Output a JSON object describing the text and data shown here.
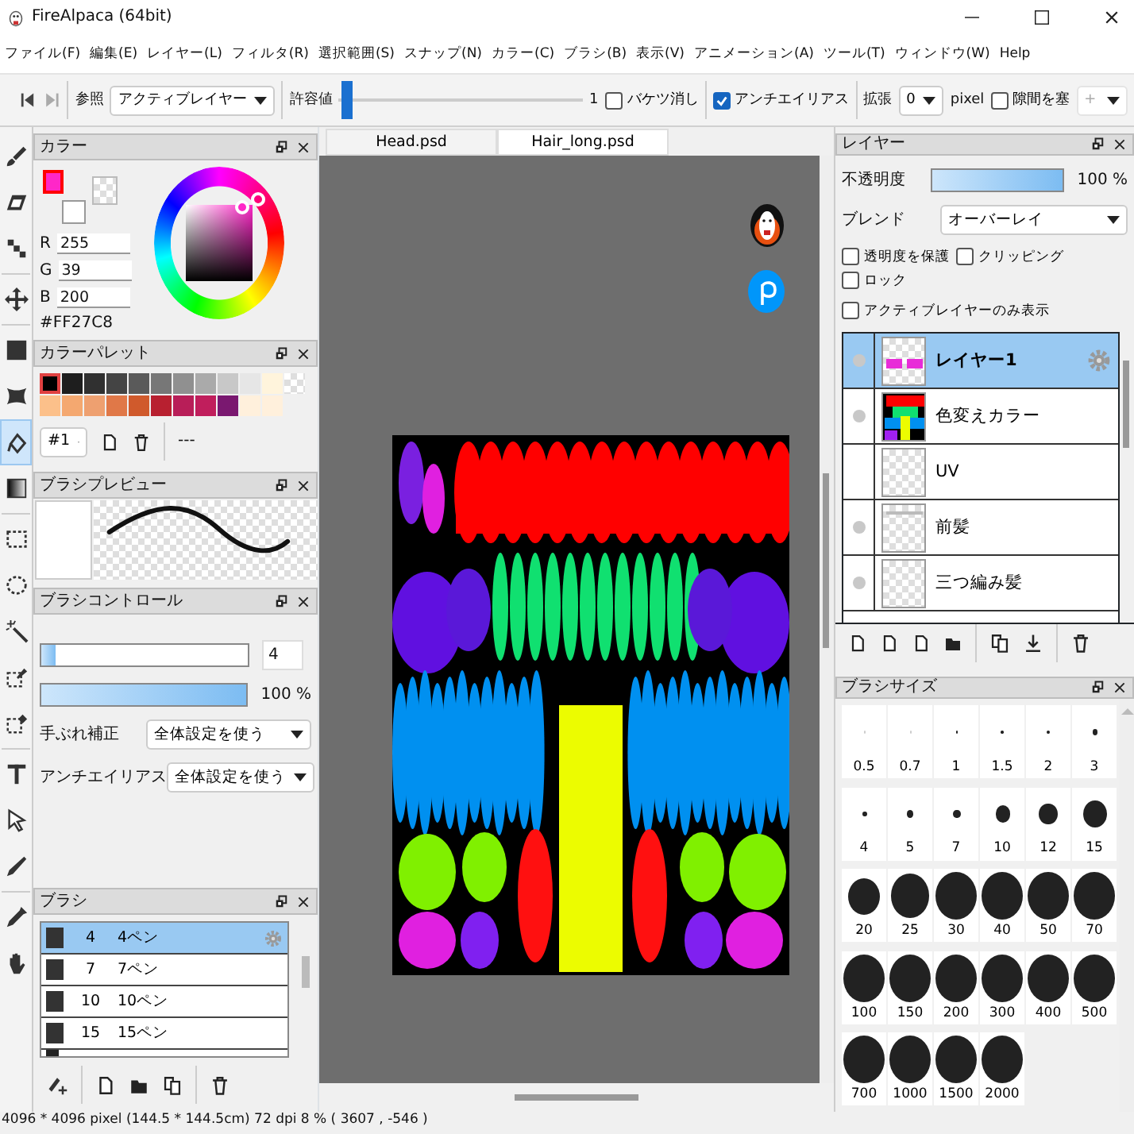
{
  "window": {
    "title": "FireAlpaca (64bit)"
  },
  "menu": [
    "ファイル(F)",
    "編集(E)",
    "レイヤー(L)",
    "フィルタ(R)",
    "選択範囲(S)",
    "スナップ(N)",
    "カラー(C)",
    "ブラシ(B)",
    "表示(V)",
    "アニメーション(A)",
    "ツール(T)",
    "ウィンドウ(W)",
    "Help"
  ],
  "toolbar": {
    "reference_label": "参照",
    "reference_value": "アクティブレイヤー",
    "tolerance_label": "許容値",
    "tolerance": {
      "level": 0.01,
      "reading": "1"
    },
    "bucket_erase": {
      "label": "バケツ消し",
      "checked": false
    },
    "antialias": {
      "label": "アンチエイリアス",
      "checked": true
    },
    "expand_label": "拡張",
    "expand_value": "0",
    "expand_unit": "pixel",
    "close_gap": {
      "label": "隙間を塞",
      "checked": false
    },
    "gap_value": "+"
  },
  "tools": [
    {
      "kind": "brush",
      "selected": false
    },
    {
      "kind": "eraser",
      "selected": false
    },
    {
      "kind": "dot",
      "selected": false
    },
    {
      "kind": "move",
      "selected": false
    },
    {
      "kind": "fill",
      "selected": false
    },
    {
      "kind": "shape",
      "selected": false
    },
    {
      "kind": "bucket",
      "selected": true
    },
    {
      "kind": "gradient",
      "selected": false
    },
    {
      "kind": "select",
      "selected": false
    },
    {
      "kind": "lasso",
      "selected": false
    },
    {
      "kind": "wand",
      "selected": false
    },
    {
      "kind": "selectpen",
      "selected": false
    },
    {
      "kind": "selecteraser",
      "selected": false
    },
    {
      "kind": "text",
      "selected": false
    },
    {
      "kind": "operation",
      "selected": false
    },
    {
      "kind": "edit",
      "selected": false
    },
    {
      "kind": "dropper",
      "selected": false
    },
    {
      "kind": "hand",
      "selected": false
    }
  ],
  "color": {
    "title": "カラー",
    "primary": {
      "color": "#ff27c8"
    },
    "channels": [
      {
        "label": "R",
        "value": "255"
      },
      {
        "label": "G",
        "value": "39"
      },
      {
        "label": "B",
        "value": "200"
      }
    ],
    "hex": "#FF27C8"
  },
  "palette": {
    "title": "カラーパレット",
    "swatches": [
      {
        "kind": "color",
        "color": "#000000",
        "selected": true
      },
      {
        "kind": "color",
        "color": "#1e1e1e",
        "selected": false
      },
      {
        "kind": "color",
        "color": "#303030",
        "selected": false
      },
      {
        "kind": "color",
        "color": "#444444",
        "selected": false
      },
      {
        "kind": "color",
        "color": "#5a5a5a",
        "selected": false
      },
      {
        "kind": "color",
        "color": "#777777",
        "selected": false
      },
      {
        "kind": "color",
        "color": "#909090",
        "selected": false
      },
      {
        "kind": "color",
        "color": "#aaaaaa",
        "selected": false
      },
      {
        "kind": "color",
        "color": "#c8c8c8",
        "selected": false
      },
      {
        "kind": "color",
        "color": "#e6e6e6",
        "selected": false
      },
      {
        "kind": "color",
        "color": "#fff4dc",
        "selected": false
      },
      {
        "kind": "transparent",
        "selected": false
      },
      {
        "kind": "color",
        "color": "#fcc08a",
        "selected": false
      },
      {
        "kind": "color",
        "color": "#f4a870",
        "selected": false
      },
      {
        "kind": "color",
        "color": "#eea070",
        "selected": false
      },
      {
        "kind": "color",
        "color": "#e07848",
        "selected": false
      },
      {
        "kind": "color",
        "color": "#d05a2c",
        "selected": false
      },
      {
        "kind": "color",
        "color": "#b82030",
        "selected": false
      },
      {
        "kind": "color",
        "color": "#b81e58",
        "selected": false
      },
      {
        "kind": "color",
        "color": "#c01e5c",
        "selected": false
      },
      {
        "kind": "color",
        "color": "#7a1870",
        "selected": false
      },
      {
        "kind": "color",
        "color": "#fff0dc",
        "selected": false
      },
      {
        "kind": "color",
        "color": "#fff0dc",
        "selected": false
      }
    ],
    "set": "#1",
    "note": "---"
  },
  "brush_preview": {
    "title": "ブラシプレビュー"
  },
  "brush_control": {
    "title": "ブラシコントロール",
    "size": {
      "level": 0.07,
      "reading": "4"
    },
    "opacity": {
      "level": 1,
      "reading": "100 %"
    },
    "stabilizer_label": "手ぶれ補正",
    "stabilizer_value": "全体設定を使う",
    "antialias_label": "アンチエイリアス",
    "antialias_value": "全体設定を使う"
  },
  "brushes": {
    "title": "ブラシ",
    "items": [
      {
        "size": "4",
        "name": "4ペン",
        "selected": true
      },
      {
        "size": "7",
        "name": "7ペン",
        "selected": false
      },
      {
        "size": "10",
        "name": "10ペン",
        "selected": false
      },
      {
        "size": "15",
        "name": "15ペン",
        "selected": false
      }
    ]
  },
  "tabs": [
    {
      "label": "Head.psd",
      "selected": false
    },
    {
      "label": "Hair_long.psd",
      "selected": true
    }
  ],
  "layers": {
    "title": "レイヤー",
    "opacity_label": "不透明度",
    "opacity": {
      "level": 1,
      "reading": "100 %"
    },
    "blend_label": "ブレンド",
    "blend_value": "オーバーレイ",
    "options": [
      {
        "label": "透明度を保護",
        "checked": false
      },
      {
        "label": "クリッピング",
        "checked": false
      },
      {
        "label": "ロック",
        "checked": false
      },
      {
        "label": "アクティブレイヤーのみ表示",
        "checked": false
      }
    ],
    "items": [
      {
        "name": "レイヤー1",
        "kind": "marks",
        "visible": true,
        "selected": true
      },
      {
        "name": "色変えカラー",
        "kind": "colormap",
        "visible": true,
        "selected": false
      },
      {
        "name": "UV",
        "kind": "empty",
        "visible": false,
        "selected": false
      },
      {
        "name": "前髪",
        "kind": "sketch",
        "visible": true,
        "selected": false
      },
      {
        "name": "三つ編み髪",
        "kind": "empty",
        "visible": true,
        "selected": false
      }
    ]
  },
  "brush_sizes": {
    "title": "ブラシサイズ",
    "sizes": [
      "0.5",
      "0.7",
      "1",
      "1.5",
      "2",
      "3",
      "4",
      "5",
      "7",
      "10",
      "12",
      "15",
      "20",
      "25",
      "30",
      "40",
      "50",
      "70",
      "100",
      "150",
      "200",
      "300",
      "400",
      "500",
      "700",
      "1000",
      "1500",
      "2000"
    ]
  },
  "status_bar": "4096 * 4096 pixel  (144.5 * 144.5cm)  72 dpi  8 %  ( 3607 , -546 )"
}
